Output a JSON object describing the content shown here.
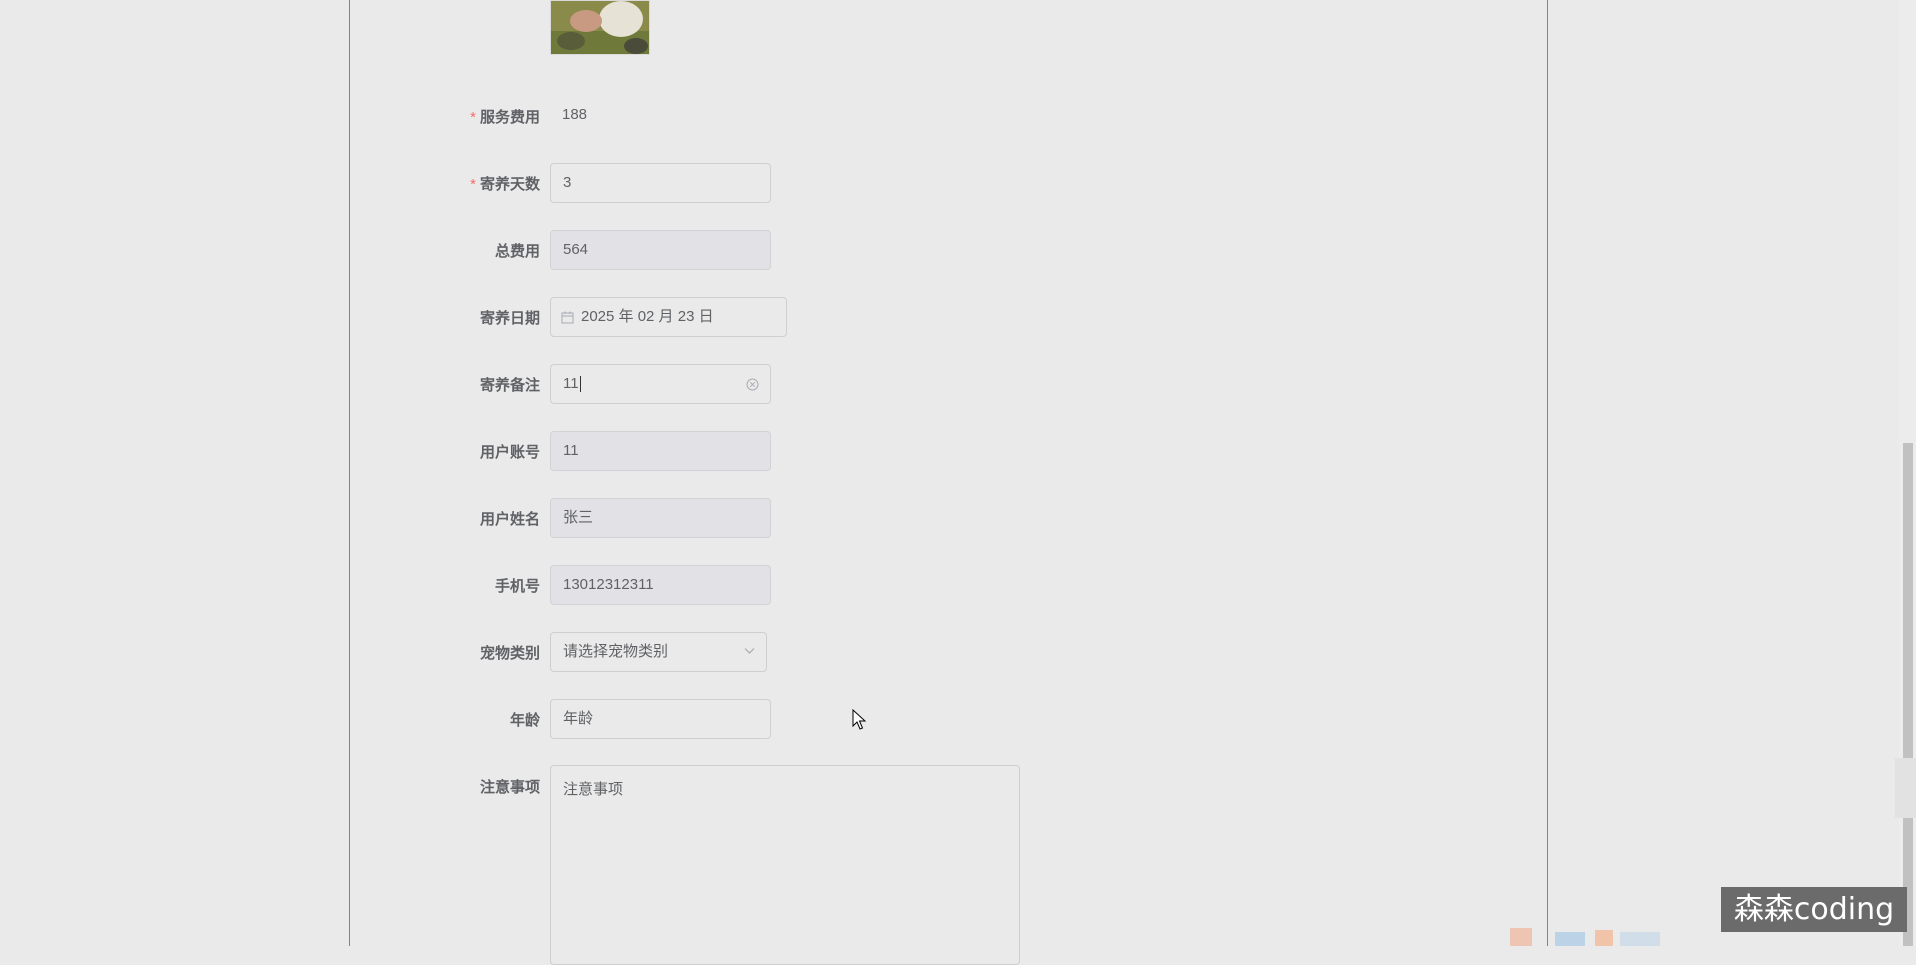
{
  "form": {
    "service_fee": {
      "label": "服务费用",
      "value": "188",
      "required": true
    },
    "board_days": {
      "label": "寄养天数",
      "value": "3",
      "required": true
    },
    "total_fee": {
      "label": "总费用",
      "value": "564"
    },
    "board_date": {
      "label": "寄养日期",
      "value": "2025 年 02 月 23 日"
    },
    "board_note": {
      "label": "寄养备注",
      "value": "11"
    },
    "user_account": {
      "label": "用户账号",
      "value": "11"
    },
    "user_name": {
      "label": "用户姓名",
      "value": "张三"
    },
    "phone": {
      "label": "手机号",
      "value": "13012312311"
    },
    "pet_category": {
      "label": "宠物类别",
      "placeholder": "请选择宠物类别"
    },
    "age": {
      "label": "年龄",
      "placeholder": "年龄"
    },
    "notes": {
      "label": "注意事项",
      "placeholder": "注意事项"
    }
  },
  "watermark": {
    "text": "森森coding"
  },
  "colors": {
    "accent_border": "#3a9bd0",
    "required": "#f56c6c",
    "background": "#eaeaea"
  }
}
